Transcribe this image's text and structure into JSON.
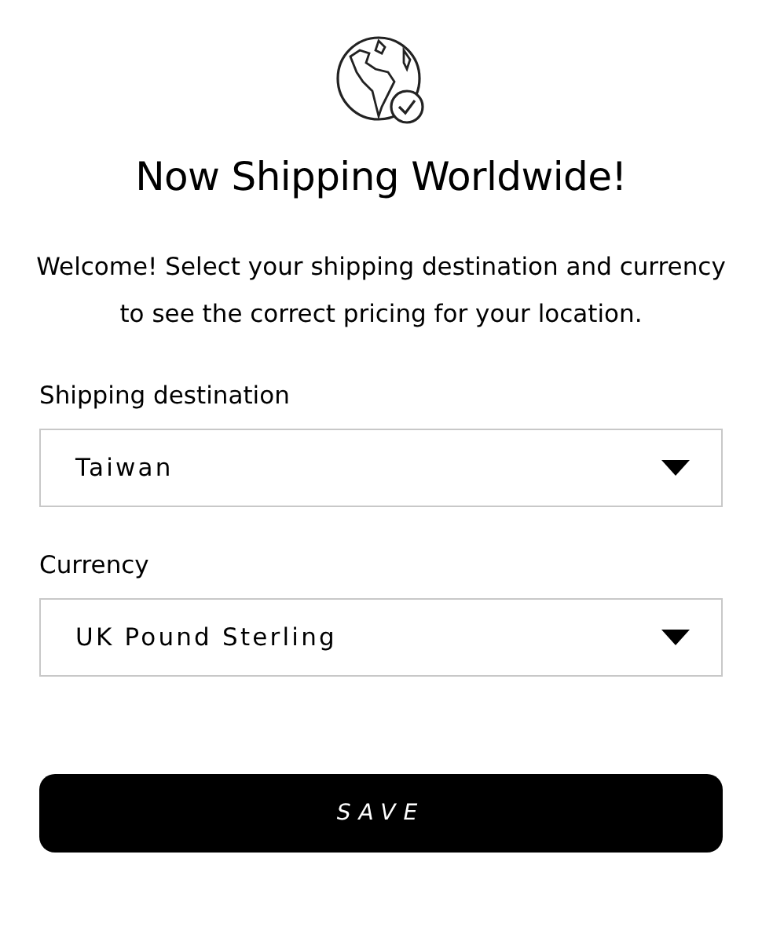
{
  "title": "Now Shipping Worldwide!",
  "intro": "Welcome! Select your shipping destination and currency to see the correct pricing for your location.",
  "fields": [
    {
      "label": "Shipping destination",
      "value": "Taiwan"
    },
    {
      "label": "Currency",
      "value": "UK Pound Sterling"
    }
  ],
  "button": "SAVE"
}
